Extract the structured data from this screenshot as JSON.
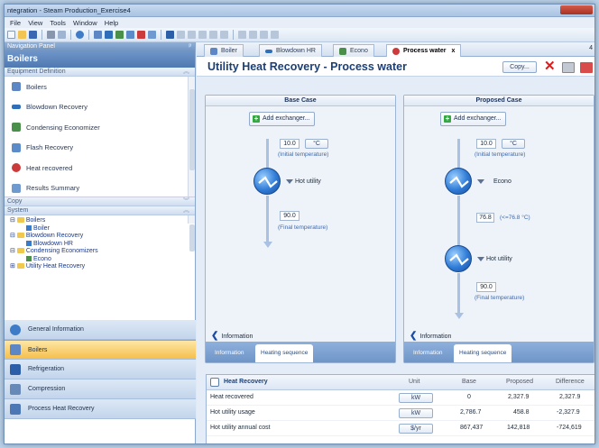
{
  "window": {
    "title": "ntegration - Steam Production_Exercise4"
  },
  "menu": {
    "items": [
      "File",
      "View",
      "Tools",
      "Window",
      "Help"
    ]
  },
  "nav": {
    "header": "Navigation Panel",
    "pin": "ᵖ",
    "section_title": "Boilers",
    "equipment_header": "Equipment Definition",
    "equipment_items": [
      "Boilers",
      "Blowdown Recovery",
      "Condensing Economizer",
      "Flash Recovery",
      "Heat recovered",
      "Results Summary"
    ],
    "copy_header": "Copy",
    "system_header": "System",
    "tree": [
      "Boilers",
      "Boiler",
      "Blowdown Recovery",
      "Blowdown HR",
      "Condensing Economizers",
      "Econo",
      "Utility Heat Recovery"
    ],
    "modules": [
      "General Information",
      "Boilers",
      "Refrigeration",
      "Compression",
      "Process Heat Recovery"
    ]
  },
  "tabs": {
    "items": [
      "Boiler",
      "Blowdown HR",
      "Econo",
      "Process water"
    ],
    "close": "x",
    "count": "4"
  },
  "page": {
    "title": "Utility Heat Recovery - Process water",
    "copy_label": "Copy..."
  },
  "base_case": {
    "title": "Base Case",
    "add_label": "Add exchanger...",
    "initial_temp": "10.0",
    "unit": "°C",
    "initial_note": "(Initial temperature)",
    "exchanger_label": "Hot utility",
    "final_temp": "90.0",
    "final_note": "(Final temperature)",
    "info_label": "Information",
    "subtab_info": "Information",
    "subtab_seq": "Heating sequence"
  },
  "proposed_case": {
    "title": "Proposed Case",
    "add_label": "Add exchanger...",
    "initial_temp": "10.0",
    "unit": "°C",
    "initial_note": "(Initial temperature)",
    "exchanger1_label": "Econo",
    "mid_temp": "76.8",
    "mid_note": "(<=76.8 °C)",
    "exchanger2_label": "Hot utility",
    "final_temp": "90.0",
    "final_note": "(Final temperature)",
    "info_label": "Information",
    "subtab_info": "Information",
    "subtab_seq": "Heating sequence"
  },
  "heat_recovery": {
    "title": "Heat Recovery",
    "columns": [
      "Unit",
      "Base",
      "Proposed",
      "Difference"
    ],
    "rows": [
      {
        "label": "Heat recovered",
        "unit": "kW",
        "base": "0",
        "proposed": "2,327.9",
        "difference": "2,327.9"
      },
      {
        "label": "Hot utility usage",
        "unit": "kW",
        "base": "2,786.7",
        "proposed": "458.8",
        "difference": "-2,327.9"
      },
      {
        "label": "Hot utility annual cost",
        "unit": "$/yr",
        "base": "867,437",
        "proposed": "142,818",
        "difference": "-724,619"
      }
    ]
  },
  "colors": {
    "accent": "#1c3f75",
    "active_module": "#f5bf4d",
    "exchanger": "#2f7bd6",
    "delete": "#d51e1e"
  }
}
